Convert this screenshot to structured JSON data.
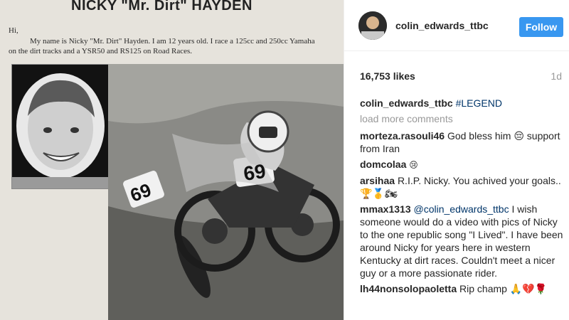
{
  "flyer": {
    "title": "NICKY \"Mr. Dirt\" HAYDEN",
    "greeting": "Hi,",
    "body": "My name is Nicky \"Mr. Dirt\" Hayden.  I am 12 years old.  I race a 125cc and 250cc Yamaha on the dirt tracks and a YSR50 and RS125 on Road Races.",
    "bike_number": "69"
  },
  "post": {
    "username": "colin_edwards_ttbc",
    "follow_label": "Follow",
    "likes": "16,753 likes",
    "time": "1d",
    "caption_user": "colin_edwards_ttbc",
    "caption_text": "#LEGEND",
    "load_more": "load more comments"
  },
  "comments": [
    {
      "user": "morteza.rasouli46",
      "text": "God bless him 😔 support from Iran"
    },
    {
      "user": "domcolaa",
      "text": "😢"
    },
    {
      "user": "arsihaa",
      "text": "R.I.P. Nicky. You achived your goals.. 🏆🥇🏍"
    },
    {
      "user": "mmax1313",
      "mention": "@colin_edwards_ttbc",
      "text": "I wish someone would do a video with pics of Nicky to the one republic song \"I Lived\". I have been around Nicky for years here in western Kentucky at dirt races. Couldn't meet a nicer guy or a more passionate rider."
    },
    {
      "user": "lh44nonsolopaoletta",
      "text": "Rip champ 🙏💔🌹"
    }
  ],
  "colors": {
    "follow": "#3897f0",
    "hashtag": "#003569",
    "muted": "#999999"
  }
}
